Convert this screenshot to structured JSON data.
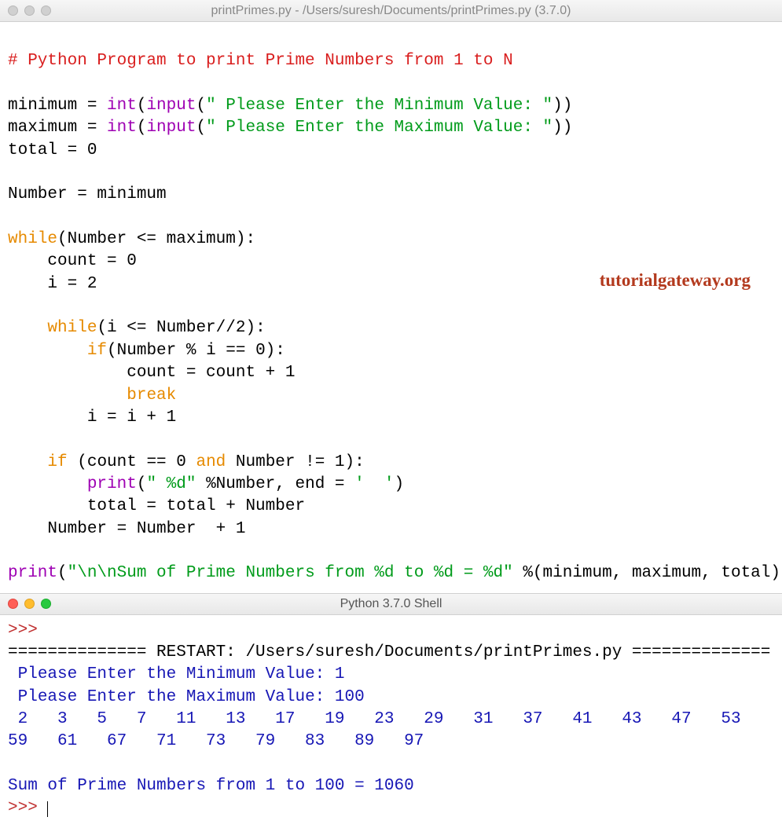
{
  "editor_window": {
    "title": "printPrimes.py - /Users/suresh/Documents/printPrimes.py (3.7.0)"
  },
  "code": {
    "l1_comment": "# Python Program to print Prime Numbers from 1 to N",
    "l3_a": "minimum = ",
    "l3_b": "int",
    "l3_c": "(",
    "l3_d": "input",
    "l3_e": "(",
    "l3_f": "\" Please Enter the Minimum Value: \"",
    "l3_g": "))",
    "l4_a": "maximum = ",
    "l4_b": "int",
    "l4_c": "(",
    "l4_d": "input",
    "l4_e": "(",
    "l4_f": "\" Please Enter the Maximum Value: \"",
    "l4_g": "))",
    "l5": "total = 0",
    "l7": "Number = minimum",
    "l9_a": "while",
    "l9_b": "(Number <= maximum):",
    "l10": "    count = 0",
    "l11": "    i = 2",
    "l13_a": "    ",
    "l13_b": "while",
    "l13_c": "(i <= Number//2):",
    "l14_a": "        ",
    "l14_b": "if",
    "l14_c": "(Number % i == 0):",
    "l15": "            count = count + 1",
    "l16_a": "            ",
    "l16_b": "break",
    "l17": "        i = i + 1",
    "l19_a": "    ",
    "l19_b": "if",
    "l19_c": " (count == 0 ",
    "l19_d": "and",
    "l19_e": " Number != 1):",
    "l20_a": "        ",
    "l20_b": "print",
    "l20_c": "(",
    "l20_d": "\" %d\"",
    "l20_e": " %Number, end = ",
    "l20_f": "'  '",
    "l20_g": ")",
    "l21": "        total = total + Number",
    "l22": "    Number = Number  + 1",
    "l24_a": "print",
    "l24_b": "(",
    "l24_c": "\"\\n\\nSum of Prime Numbers from %d to %d = %d\"",
    "l24_d": " %(minimum, maximum, total))"
  },
  "watermark": "tutorialgateway.org",
  "shell_window": {
    "title": "Python 3.7.0 Shell"
  },
  "shell": {
    "prompt": ">>> ",
    "sep1": "============== ",
    "restart": "RESTART: /Users/suresh/Documents/printPrimes.py",
    "sep2": " ==============",
    "in1": " Please Enter the Minimum Value: 1",
    "in2": " Please Enter the Maximum Value: 100",
    "out1": " 2   3   5   7   11   13   17   19   23   29   31   37   41   43   47   53   59   61   67   71   73   79   83   89   97  ",
    "out2": "Sum of Prime Numbers from 1 to 100 = 1060"
  }
}
